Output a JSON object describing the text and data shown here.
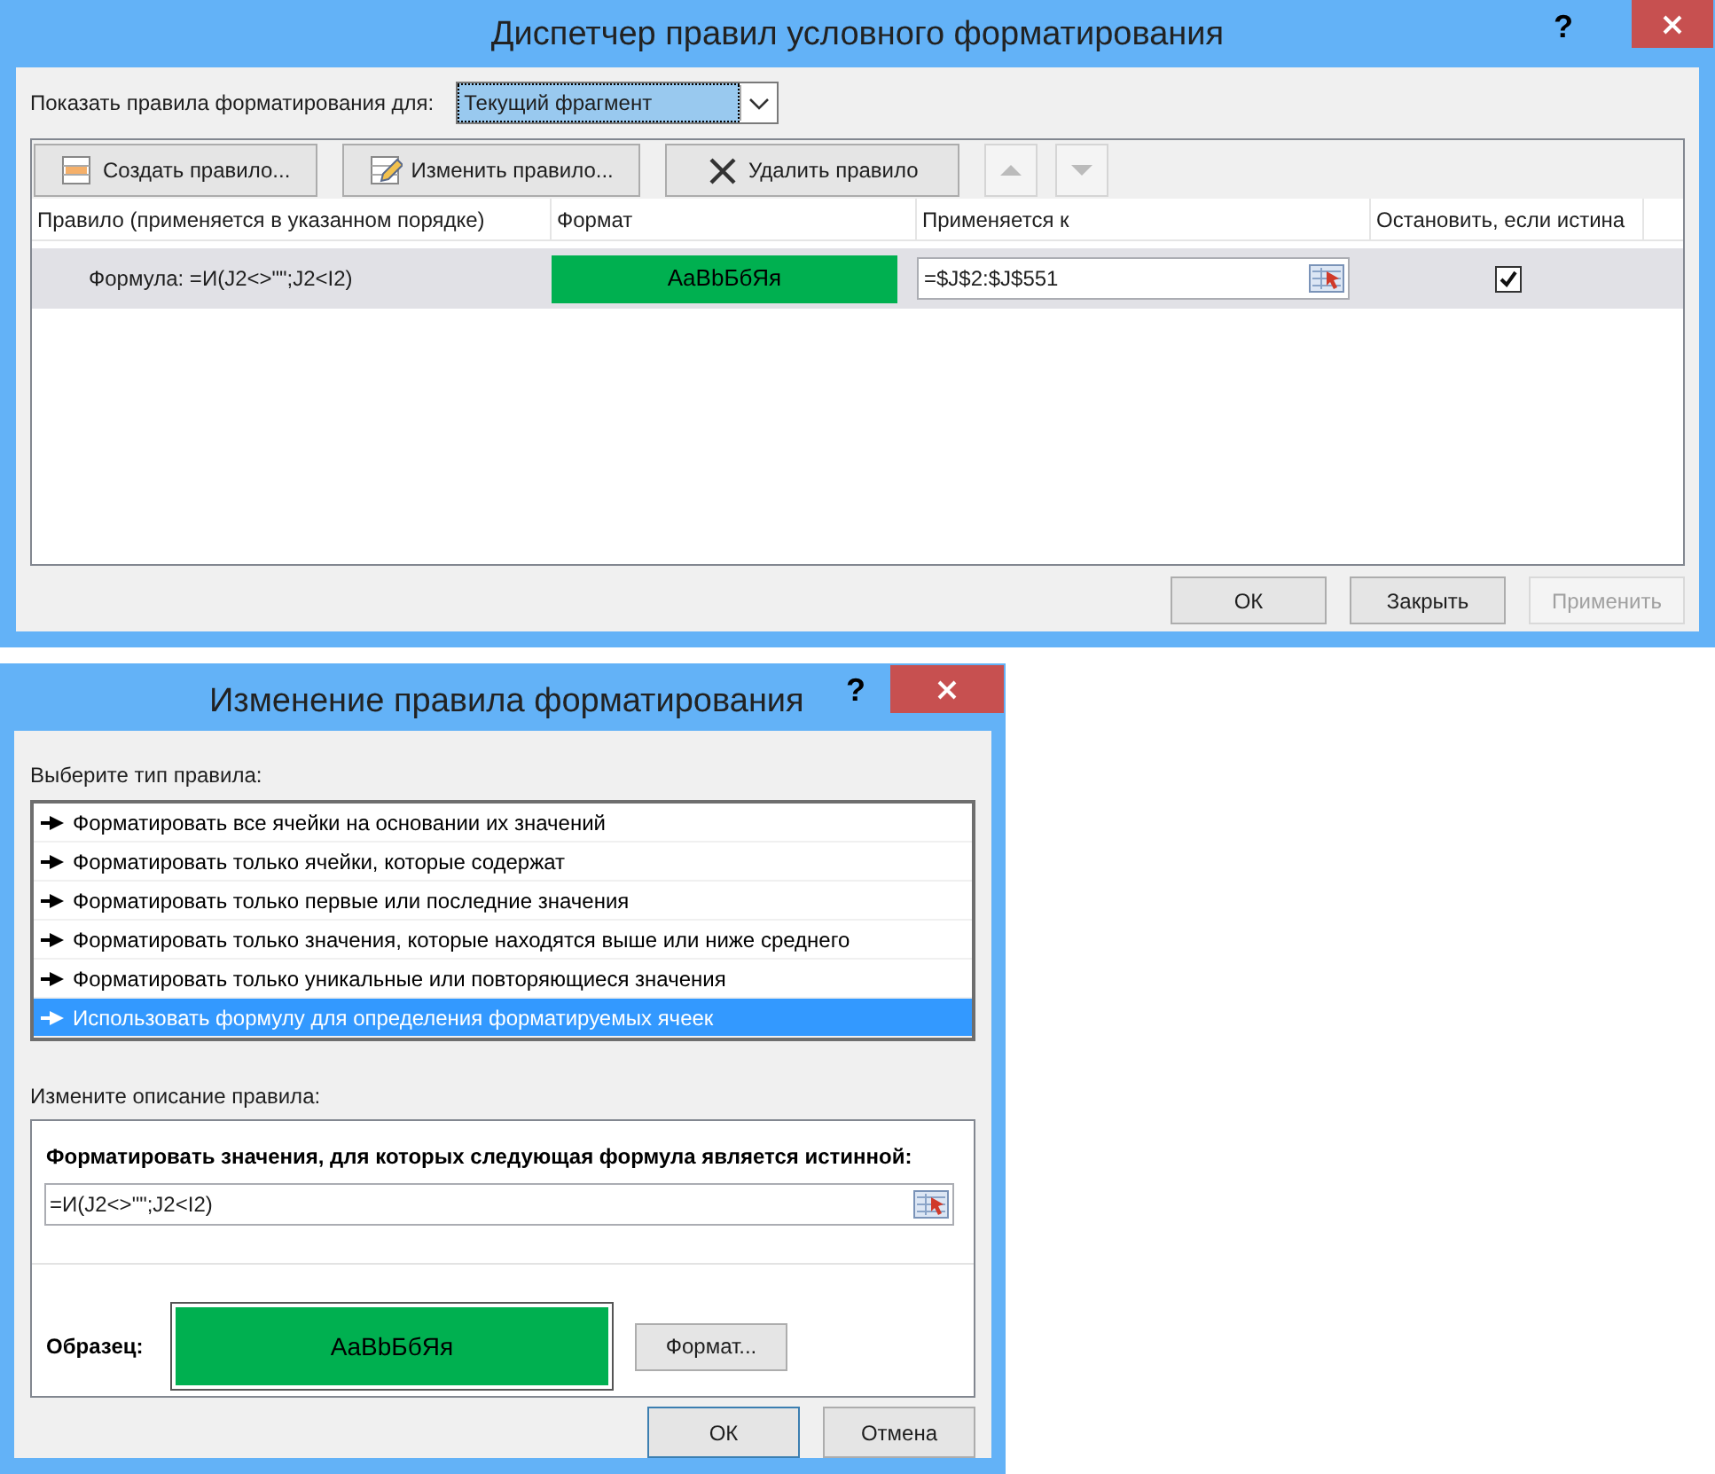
{
  "manager_dialog": {
    "title": "Диспетчер правил условного форматирования",
    "help": "?",
    "show_rules_label": "Показать правила форматирования для:",
    "show_rules_value": "Текущий фрагмент",
    "toolbar": [
      {
        "kind": "new",
        "label": "Создать правило...",
        "disabled": false
      },
      {
        "kind": "edit",
        "label": "Изменить правило...",
        "disabled": false
      },
      {
        "kind": "delete",
        "label": "Удалить правило",
        "disabled": false
      },
      {
        "kind": "move_up",
        "disabled": true
      },
      {
        "kind": "move_down",
        "disabled": true
      }
    ],
    "columns": [
      "Правило (применяется в указанном порядке)",
      "Формат",
      "Применяется к",
      "Остановить, если истина"
    ],
    "rules": [
      {
        "rule": "Формула: =И(J2<>\"\";J2<I2)",
        "format_sample": "AaBbБбЯя",
        "applies_to": "=$J$2:$J$551",
        "stop_if_true": true,
        "selected": true
      }
    ],
    "buttons": [
      {
        "label": "ОК",
        "disabled": false
      },
      {
        "label": "Закрыть",
        "disabled": false
      },
      {
        "label": "Применить",
        "disabled": true
      }
    ]
  },
  "edit_dialog": {
    "title": "Изменение правила форматирования",
    "help": "?",
    "rule_type_label": "Выберите тип правила:",
    "rule_types": [
      {
        "label": "Форматировать все ячейки на основании их значений",
        "selected": false
      },
      {
        "label": "Форматировать только ячейки, которые содержат",
        "selected": false
      },
      {
        "label": "Форматировать только первые или последние значения",
        "selected": false
      },
      {
        "label": "Форматировать только значения, которые находятся выше или ниже среднего",
        "selected": false
      },
      {
        "label": "Форматировать только уникальные или повторяющиеся значения",
        "selected": false
      },
      {
        "label": "Использовать формулу для определения форматируемых ячеек",
        "selected": true
      }
    ],
    "description_label": "Измените описание правила:",
    "formula_label": "Форматировать значения, для которых следующая формула является истинной:",
    "formula": "=И(J2<>\"\";J2<I2)",
    "sample_label": "Образец:",
    "sample_text": "AaBbБбЯя",
    "format_button": "Формат...",
    "buttons": [
      {
        "label": "ОК",
        "focused": true
      },
      {
        "label": "Отмена",
        "focused": false
      }
    ]
  }
}
